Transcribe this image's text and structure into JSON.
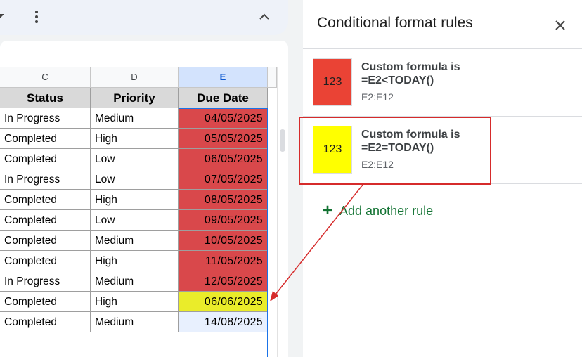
{
  "toolbar": {
    "menu_icon": "kebab-icon",
    "collapse_icon": "chevron-up-icon"
  },
  "sheet": {
    "columns": [
      {
        "letter": "C"
      },
      {
        "letter": "D"
      },
      {
        "letter": "E",
        "selected": true
      }
    ],
    "headers": [
      "Status",
      "Priority",
      "Due Date"
    ],
    "rows": [
      {
        "status": "In Progress",
        "priority": "Medium",
        "due": "04/05/2025",
        "fill": "red"
      },
      {
        "status": "Completed",
        "priority": "High",
        "due": "05/05/2025",
        "fill": "red"
      },
      {
        "status": "Completed",
        "priority": "Low",
        "due": "06/05/2025",
        "fill": "red"
      },
      {
        "status": "In Progress",
        "priority": "Low",
        "due": "07/05/2025",
        "fill": "red"
      },
      {
        "status": "Completed",
        "priority": "High",
        "due": "08/05/2025",
        "fill": "red"
      },
      {
        "status": "Completed",
        "priority": "Low",
        "due": "09/05/2025",
        "fill": "red"
      },
      {
        "status": "Completed",
        "priority": "Medium",
        "due": "10/05/2025",
        "fill": "red"
      },
      {
        "status": "Completed",
        "priority": "High",
        "due": "11/05/2025",
        "fill": "red"
      },
      {
        "status": "In Progress",
        "priority": "Medium",
        "due": "12/05/2025",
        "fill": "red"
      },
      {
        "status": "Completed",
        "priority": "High",
        "due": "06/06/2025",
        "fill": "yellow"
      },
      {
        "status": "Completed",
        "priority": "Medium",
        "due": "14/08/2025",
        "fill": "plain"
      }
    ]
  },
  "panel": {
    "title": "Conditional format rules",
    "close_icon": "close-icon",
    "rules": [
      {
        "preview": "123",
        "color": "#ea4335",
        "line1": "Custom formula is",
        "line2": "=E2<TODAY()",
        "range": "E2:E12"
      },
      {
        "preview": "123",
        "color": "#ffff00",
        "line1": "Custom formula is",
        "line2": "=E2=TODAY()",
        "range": "E2:E12"
      }
    ],
    "add_rule": "Add another rule"
  },
  "colors": {
    "overdue": "#d9484b",
    "today": "#eaec2a",
    "selection": "#1a73e8",
    "annotation": "#d62b2b",
    "add_rule": "#137333"
  }
}
